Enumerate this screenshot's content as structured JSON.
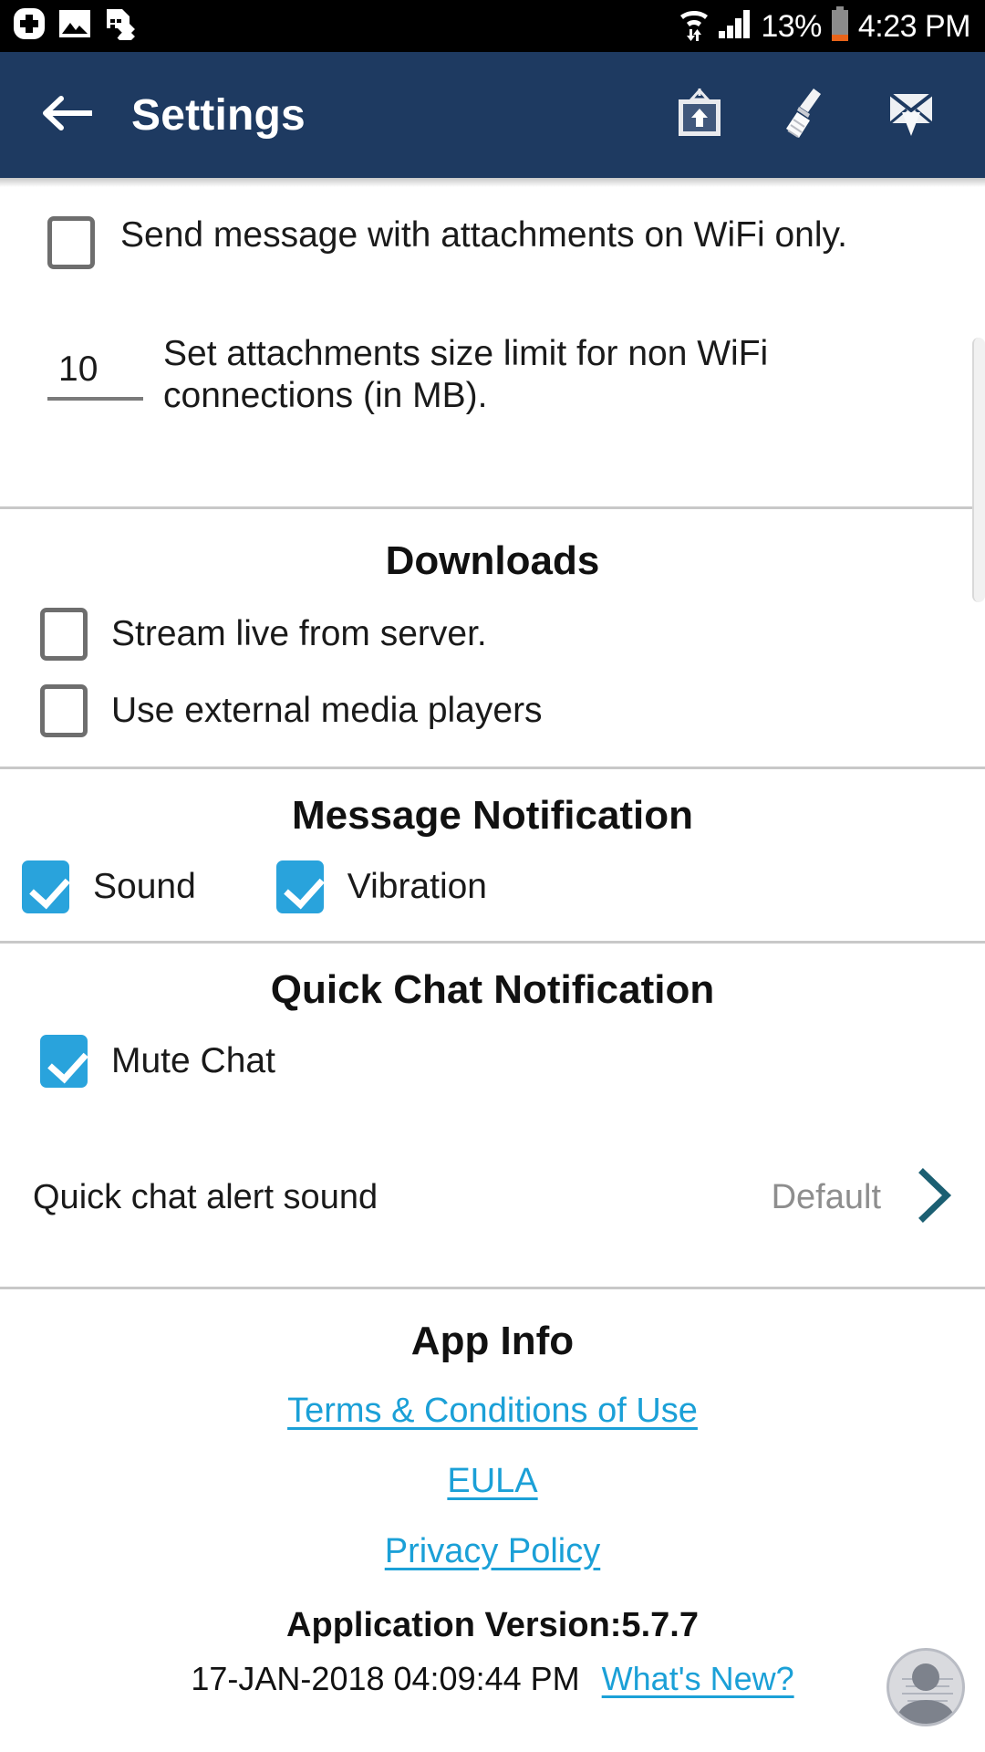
{
  "status_bar": {
    "time": "4:23 PM",
    "battery_percent": "13%",
    "icons": [
      "medical-cross-icon",
      "image-icon",
      "sim-card-error-icon",
      "wifi-transfer-icon",
      "cellular-signal-icon",
      "battery-low-icon"
    ]
  },
  "app_bar": {
    "title": "Settings",
    "back_icon": "back-arrow-icon",
    "actions": [
      "upload-picture-icon",
      "broom-clean-icon",
      "fetch-mail-icon"
    ]
  },
  "attachments": {
    "wifi_only_label": "Send message with attachments on WiFi only.",
    "wifi_only_checked": false,
    "size_limit_value": "10",
    "size_limit_label": "Set attachments size limit for non WiFi connections (in MB)."
  },
  "downloads": {
    "title": "Downloads",
    "items": [
      {
        "label": "Stream live from server.",
        "checked": false
      },
      {
        "label": "Use external media players",
        "checked": false
      }
    ]
  },
  "message_notification": {
    "title": "Message Notification",
    "items": [
      {
        "label": "Sound",
        "checked": true
      },
      {
        "label": "Vibration",
        "checked": true
      }
    ]
  },
  "quick_chat": {
    "title": "Quick Chat Notification",
    "mute_label": "Mute Chat",
    "mute_checked": true,
    "alert_sound_label": "Quick chat alert sound",
    "alert_sound_value": "Default",
    "chevron_icon": "chevron-right-icon"
  },
  "app_info": {
    "title": "App Info",
    "links": [
      "Terms & Conditions of Use",
      "EULA",
      "Privacy Policy"
    ],
    "version": "Application Version:5.7.7",
    "build_date": "17-JAN-2018 04:09:44 PM",
    "whats_new": "What's New?"
  },
  "colors": {
    "appbar": "#1e3a61",
    "checked": "#29a3dc",
    "link": "#1ba0d7",
    "chevron": "#1b5f72",
    "muted": "#8e8e8e",
    "battery_low": "#e8641a"
  }
}
